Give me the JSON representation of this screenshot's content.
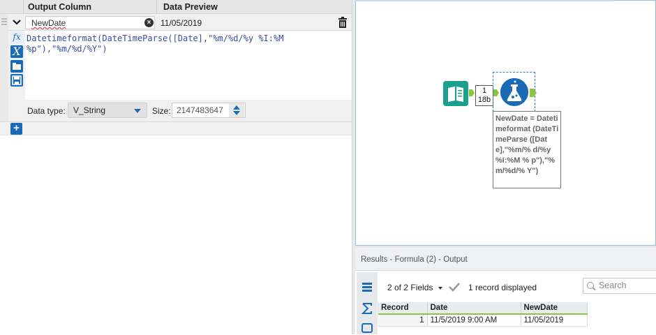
{
  "formula_panel": {
    "headers": {
      "output_column": "Output Column",
      "data_preview": "Data Preview"
    },
    "row": {
      "output_name": "NewDate",
      "preview_value": "11/05/2019",
      "expression_line1": "Datetimeformat(DateTimeParse([Date],\"%m/%d/%y %I:%M",
      "expression_line2": "%p\"),\"%m/%d/%Y\")",
      "data_type_label": "Data type:",
      "data_type_value": "V_String",
      "size_label": "Size:",
      "size_value": "2147483647"
    },
    "icons": {
      "fx": "fx",
      "variables": "X"
    },
    "add_label": "+"
  },
  "canvas": {
    "connection_badge_line1": "1",
    "connection_badge_line2": "18b",
    "annotation": "NewDate = Datetimeformat (DateTimeParse ([Date],\"%m/% d/%y %I:%M % p\"),\"%m/%d/% Y\")"
  },
  "results": {
    "title": "Results - Formula (2) - Output",
    "fields_dropdown": "2 of 2 Fields",
    "record_count": "1 record displayed",
    "search_placeholder": "Search",
    "columns": [
      "Record",
      "Date",
      "NewDate"
    ],
    "rows": [
      {
        "record": "1",
        "date": "11/5/2019 9:00 AM",
        "newdate": "11/05/2019"
      }
    ]
  },
  "colors": {
    "accent": "#1a6ab5",
    "connector": "#8cc63f",
    "input_tool": "#1aa08c"
  }
}
